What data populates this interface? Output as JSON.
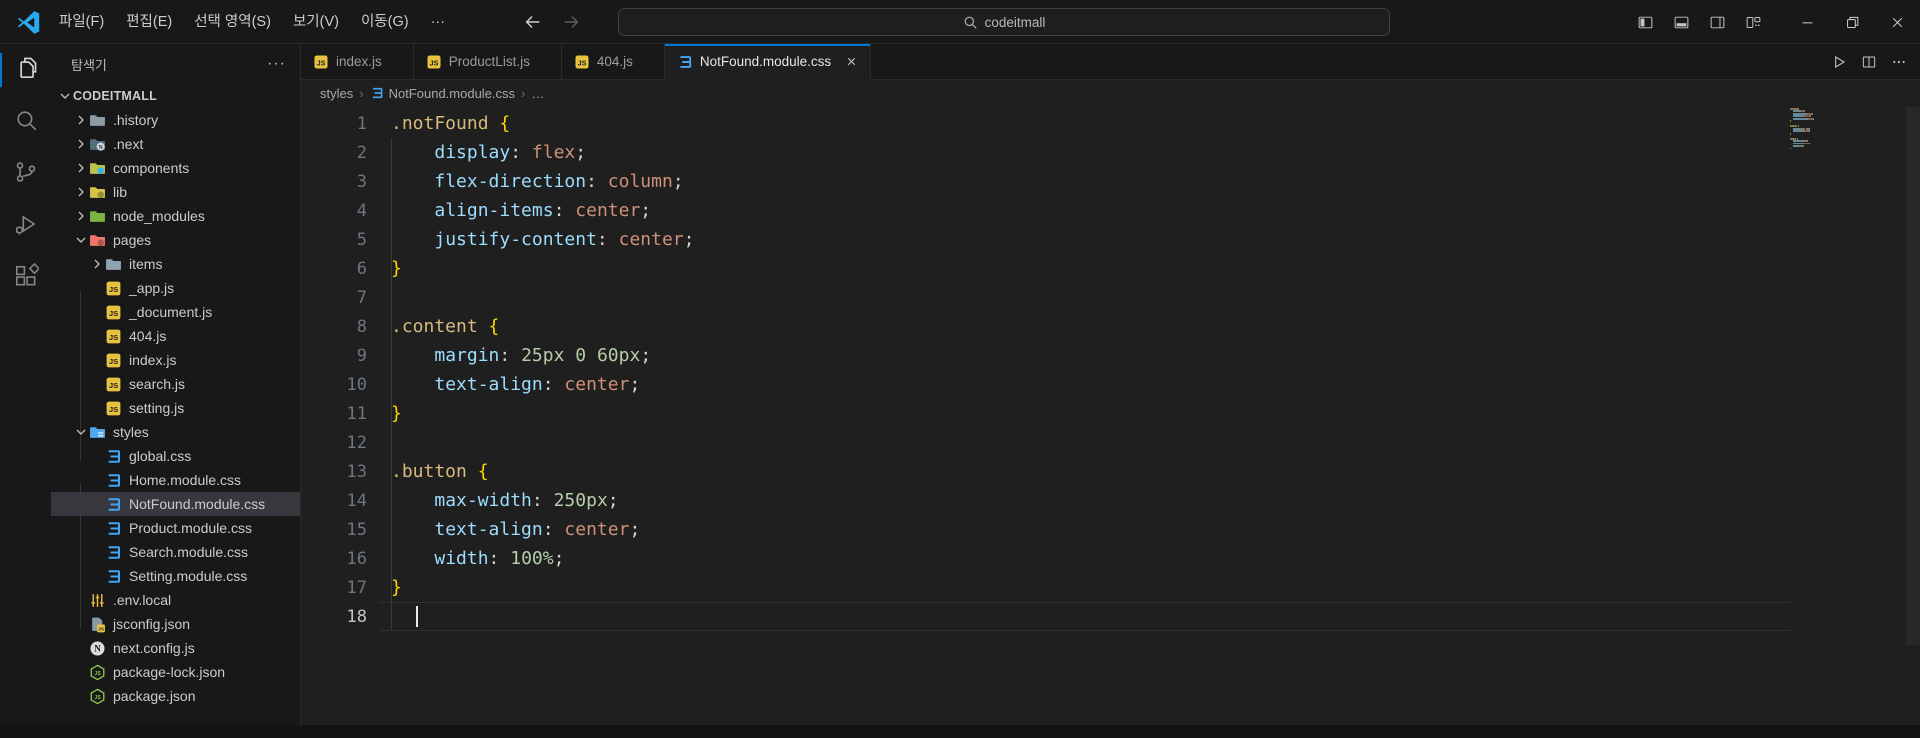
{
  "title_bar": {
    "menus": [
      {
        "label": "파일(F)"
      },
      {
        "label": "편집(E)"
      },
      {
        "label": "선택 영역(S)"
      },
      {
        "label": "보기(V)"
      },
      {
        "label": "이동(G)"
      },
      {
        "label": "···"
      }
    ],
    "command_center": {
      "text": "codeitmall"
    }
  },
  "activity_bar": [
    {
      "icon": "explorer-icon",
      "active": true
    },
    {
      "icon": "search-icon",
      "active": false
    },
    {
      "icon": "source-control-icon",
      "active": false
    },
    {
      "icon": "run-debug-icon",
      "active": false
    },
    {
      "icon": "extensions-icon",
      "active": false
    }
  ],
  "sidebar": {
    "title": "탐색기",
    "more_label": "···",
    "tree": [
      {
        "label": "CODEITMALL",
        "kind": "root",
        "expanded": true,
        "level": 0
      },
      {
        "label": ".history",
        "kind": "folder",
        "color": "#8d9ba3",
        "level": 1
      },
      {
        "label": ".next",
        "kind": "folder",
        "color": "#546e7a",
        "badge": "N",
        "level": 1
      },
      {
        "label": "components",
        "kind": "folder",
        "color": "#bcc24c",
        "badge": "dot-blue",
        "level": 1
      },
      {
        "label": "lib",
        "kind": "folder",
        "color": "#d4c54a",
        "badge": "dot-dark",
        "level": 1
      },
      {
        "label": "node_modules",
        "kind": "folder",
        "color": "#7cb342",
        "level": 1
      },
      {
        "label": "pages",
        "kind": "folder",
        "color": "#f0756a",
        "badge": "dot-dark",
        "expanded": true,
        "level": 1
      },
      {
        "label": "items",
        "kind": "folder",
        "color": "#8da4b0",
        "level": 2
      },
      {
        "label": "_app.js",
        "kind": "file",
        "icon": "js-file-icon",
        "level": 2
      },
      {
        "label": "_document.js",
        "kind": "file",
        "icon": "js-file-icon",
        "level": 2
      },
      {
        "label": "404.js",
        "kind": "file",
        "icon": "js-file-icon",
        "level": 2
      },
      {
        "label": "index.js",
        "kind": "file",
        "icon": "js-file-icon",
        "level": 2
      },
      {
        "label": "search.js",
        "kind": "file",
        "icon": "js-file-icon",
        "level": 2
      },
      {
        "label": "setting.js",
        "kind": "file",
        "icon": "js-file-icon",
        "level": 2
      },
      {
        "label": "styles",
        "kind": "folder",
        "color": "#4fa8ee",
        "badge": "stripes",
        "expanded": true,
        "level": 1
      },
      {
        "label": "global.css",
        "kind": "file",
        "icon": "css-file-icon",
        "level": 2
      },
      {
        "label": "Home.module.css",
        "kind": "file",
        "icon": "css-file-icon",
        "level": 2
      },
      {
        "label": "NotFound.module.css",
        "kind": "file",
        "icon": "css-file-icon",
        "level": 2,
        "selected": true
      },
      {
        "label": "Product.module.css",
        "kind": "file",
        "icon": "css-file-icon",
        "level": 2
      },
      {
        "label": "Search.module.css",
        "kind": "file",
        "icon": "css-file-icon",
        "level": 2
      },
      {
        "label": "Setting.module.css",
        "kind": "file",
        "icon": "css-file-icon",
        "level": 2
      },
      {
        "label": ".env.local",
        "kind": "file",
        "icon": "env-icon",
        "level": 1
      },
      {
        "label": "jsconfig.json",
        "kind": "file",
        "icon": "jsconfig-icon",
        "level": 1
      },
      {
        "label": "next.config.js",
        "kind": "file",
        "icon": "nextjs-icon",
        "level": 1
      },
      {
        "label": "package-lock.json",
        "kind": "file",
        "icon": "package-icon",
        "level": 1
      },
      {
        "label": "package.json",
        "kind": "file",
        "icon": "package-icon",
        "level": 1
      }
    ]
  },
  "tabs": [
    {
      "label": "index.js",
      "icon": "js-file-icon",
      "active": false
    },
    {
      "label": "ProductList.js",
      "icon": "js-file-icon",
      "active": false
    },
    {
      "label": "404.js",
      "icon": "js-file-icon",
      "active": false
    },
    {
      "label": "NotFound.module.css",
      "icon": "css-file-icon",
      "active": true
    }
  ],
  "editor_actions": [
    {
      "icon": "run-icon"
    },
    {
      "icon": "split-editor-icon"
    },
    {
      "icon": "more-actions-icon"
    }
  ],
  "breadcrumb": [
    {
      "label": "styles"
    },
    {
      "label": "NotFound.module.css",
      "icon": "css-file-icon"
    },
    {
      "label": "…"
    }
  ],
  "editor": {
    "cursor": {
      "line": 18,
      "column": 3
    },
    "code": {
      "lines": [
        {
          "n": 1,
          "tokens": [
            [
              "sel",
              ".notFound"
            ],
            [
              "plain",
              " "
            ],
            [
              "brace",
              "{"
            ]
          ]
        },
        {
          "n": 2,
          "tokens": [
            [
              "plain",
              "    "
            ],
            [
              "prop",
              "display"
            ],
            [
              "punc",
              ": "
            ],
            [
              "val",
              "flex"
            ],
            [
              "punc",
              ";"
            ]
          ]
        },
        {
          "n": 3,
          "tokens": [
            [
              "plain",
              "    "
            ],
            [
              "prop",
              "flex-direction"
            ],
            [
              "punc",
              ": "
            ],
            [
              "val",
              "column"
            ],
            [
              "punc",
              ";"
            ]
          ]
        },
        {
          "n": 4,
          "tokens": [
            [
              "plain",
              "    "
            ],
            [
              "prop",
              "align-items"
            ],
            [
              "punc",
              ": "
            ],
            [
              "val",
              "center"
            ],
            [
              "punc",
              ";"
            ]
          ]
        },
        {
          "n": 5,
          "tokens": [
            [
              "plain",
              "    "
            ],
            [
              "prop",
              "justify-content"
            ],
            [
              "punc",
              ": "
            ],
            [
              "val",
              "center"
            ],
            [
              "punc",
              ";"
            ]
          ]
        },
        {
          "n": 6,
          "tokens": [
            [
              "brace",
              "}"
            ]
          ]
        },
        {
          "n": 7,
          "tokens": []
        },
        {
          "n": 8,
          "tokens": [
            [
              "sel",
              ".content"
            ],
            [
              "plain",
              " "
            ],
            [
              "brace",
              "{"
            ]
          ]
        },
        {
          "n": 9,
          "tokens": [
            [
              "plain",
              "    "
            ],
            [
              "prop",
              "margin"
            ],
            [
              "punc",
              ": "
            ],
            [
              "num",
              "25px"
            ],
            [
              "plain",
              " "
            ],
            [
              "num",
              "0"
            ],
            [
              "plain",
              " "
            ],
            [
              "num",
              "60px"
            ],
            [
              "punc",
              ";"
            ]
          ]
        },
        {
          "n": 10,
          "tokens": [
            [
              "plain",
              "    "
            ],
            [
              "prop",
              "text-align"
            ],
            [
              "punc",
              ": "
            ],
            [
              "val",
              "center"
            ],
            [
              "punc",
              ";"
            ]
          ]
        },
        {
          "n": 11,
          "tokens": [
            [
              "brace",
              "}"
            ]
          ]
        },
        {
          "n": 12,
          "tokens": []
        },
        {
          "n": 13,
          "tokens": [
            [
              "sel",
              ".button"
            ],
            [
              "plain",
              " "
            ],
            [
              "brace",
              "{"
            ]
          ]
        },
        {
          "n": 14,
          "tokens": [
            [
              "plain",
              "    "
            ],
            [
              "prop",
              "max-width"
            ],
            [
              "punc",
              ": "
            ],
            [
              "num",
              "250px"
            ],
            [
              "punc",
              ";"
            ]
          ]
        },
        {
          "n": 15,
          "tokens": [
            [
              "plain",
              "    "
            ],
            [
              "prop",
              "text-align"
            ],
            [
              "punc",
              ": "
            ],
            [
              "val",
              "center"
            ],
            [
              "punc",
              ";"
            ]
          ]
        },
        {
          "n": 16,
          "tokens": [
            [
              "plain",
              "    "
            ],
            [
              "prop",
              "width"
            ],
            [
              "punc",
              ": "
            ],
            [
              "num",
              "100%"
            ],
            [
              "punc",
              ";"
            ]
          ]
        },
        {
          "n": 17,
          "tokens": [
            [
              "brace",
              "}"
            ]
          ]
        },
        {
          "n": 18,
          "tokens": []
        }
      ]
    }
  },
  "colors": {
    "accent": "#0078d4",
    "selection_bg": "#37373d",
    "selector": "#d7ba7d",
    "property": "#9cdcfe",
    "value": "#ce9178",
    "number": "#b5cea8",
    "brace": "#ffd700",
    "line_number": "#6e7681",
    "js_icon": "#e8c341",
    "css_icon": "#42a5f5"
  }
}
